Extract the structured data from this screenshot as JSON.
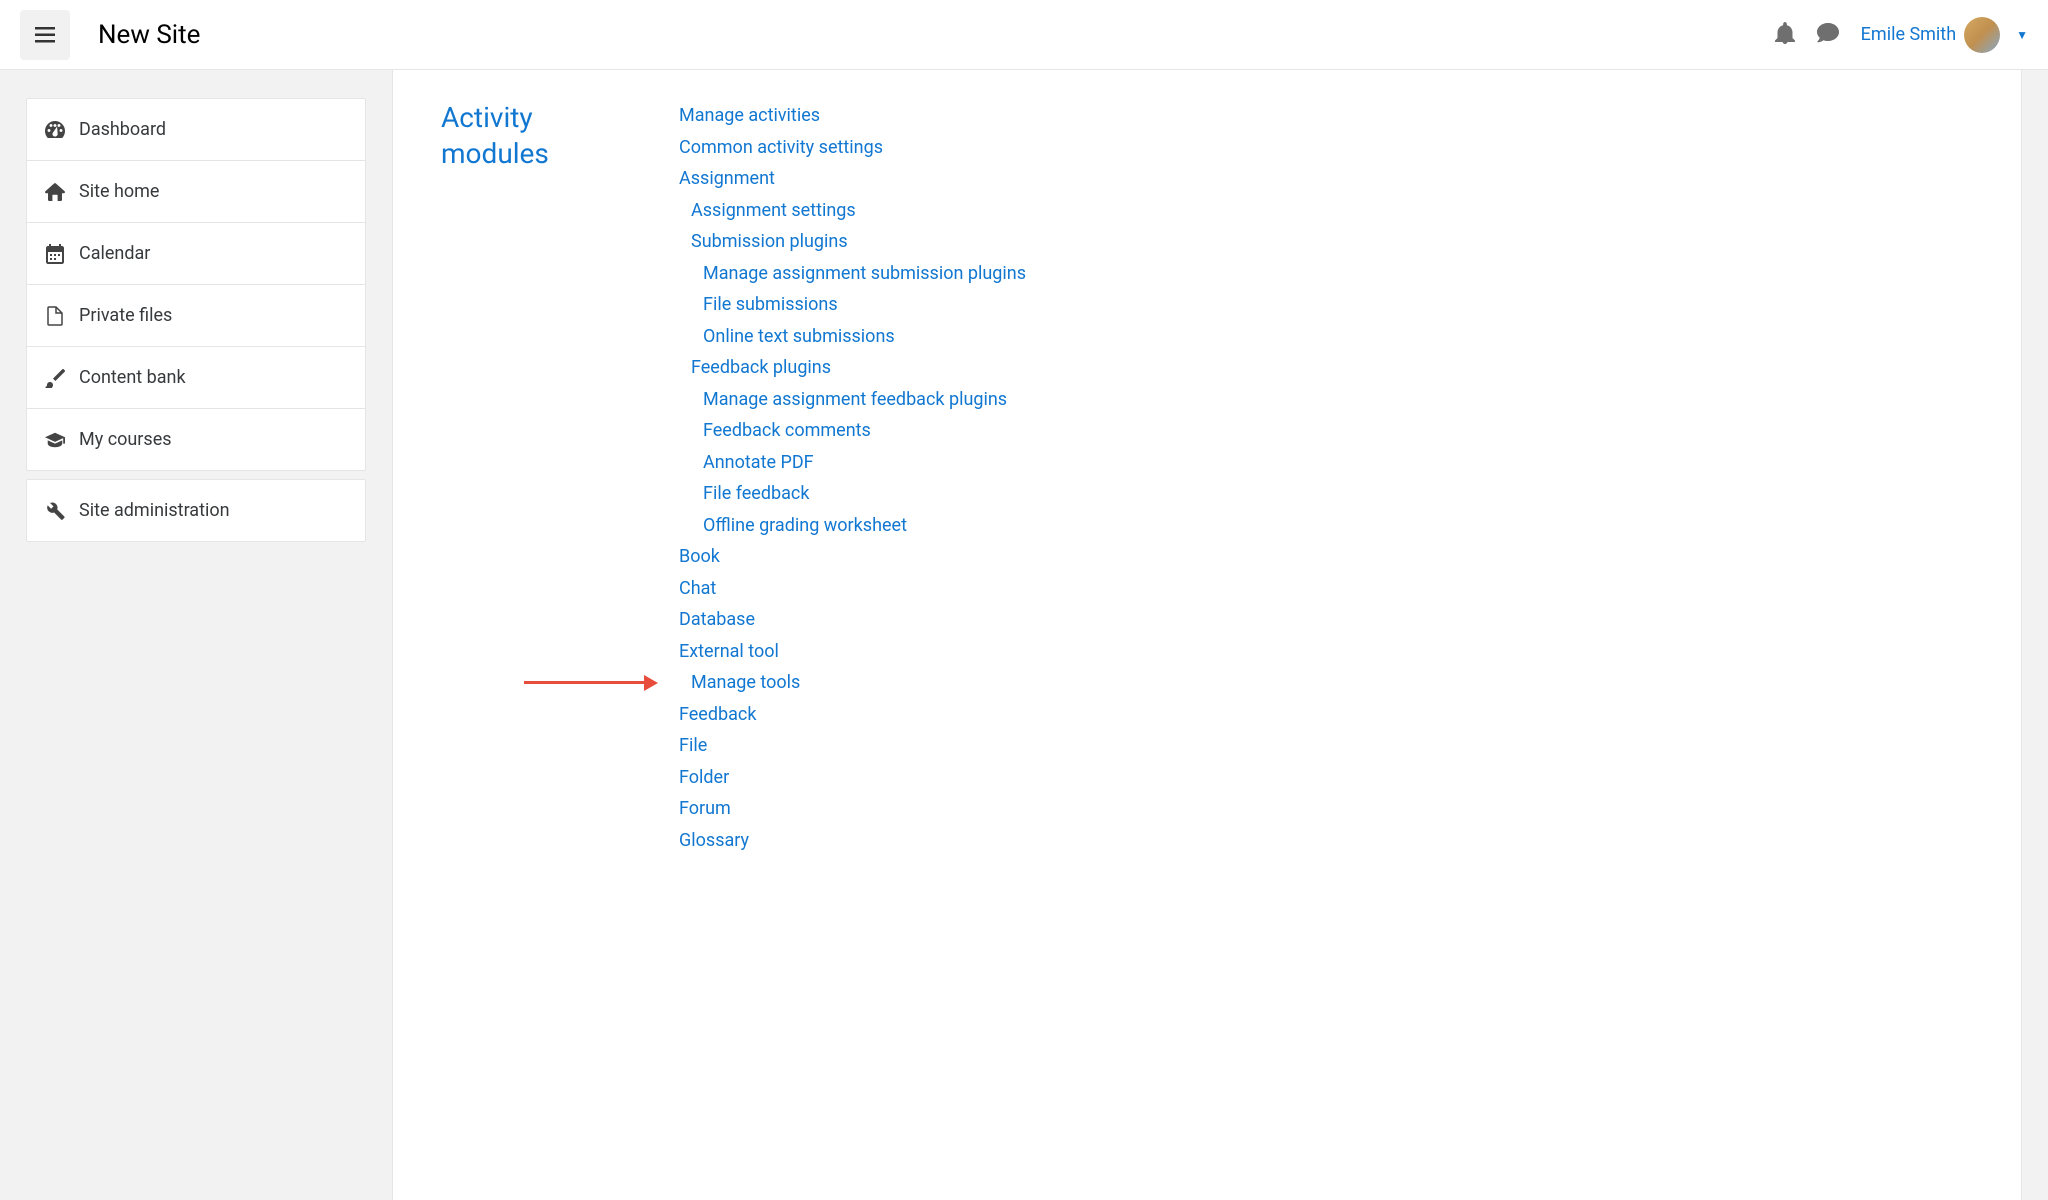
{
  "header": {
    "site_name": "New Site",
    "user_name": "Emile Smith"
  },
  "sidebar": {
    "group1": [
      {
        "label": "Dashboard",
        "icon": "dashboard"
      },
      {
        "label": "Site home",
        "icon": "home"
      },
      {
        "label": "Calendar",
        "icon": "calendar"
      },
      {
        "label": "Private files",
        "icon": "file"
      },
      {
        "label": "Content bank",
        "icon": "brush"
      },
      {
        "label": "My courses",
        "icon": "graduation"
      }
    ],
    "group2": [
      {
        "label": "Site administration",
        "icon": "wrench"
      }
    ]
  },
  "content": {
    "section_title": "Activity modules",
    "links": {
      "manage_activities": "Manage activities",
      "common_activity_settings": "Common activity settings",
      "assignment": "Assignment",
      "assignment_settings": "Assignment settings",
      "submission_plugins": "Submission plugins",
      "manage_submission_plugins": "Manage assignment submission plugins",
      "file_submissions": "File submissions",
      "online_text_submissions": "Online text submissions",
      "feedback_plugins": "Feedback plugins",
      "manage_feedback_plugins": "Manage assignment feedback plugins",
      "feedback_comments": "Feedback comments",
      "annotate_pdf": "Annotate PDF",
      "file_feedback": "File feedback",
      "offline_grading_worksheet": "Offline grading worksheet",
      "book": "Book",
      "chat": "Chat",
      "database": "Database",
      "external_tool": "External tool",
      "manage_tools": "Manage tools",
      "feedback": "Feedback",
      "file": "File",
      "folder": "Folder",
      "forum": "Forum",
      "glossary": "Glossary"
    }
  }
}
